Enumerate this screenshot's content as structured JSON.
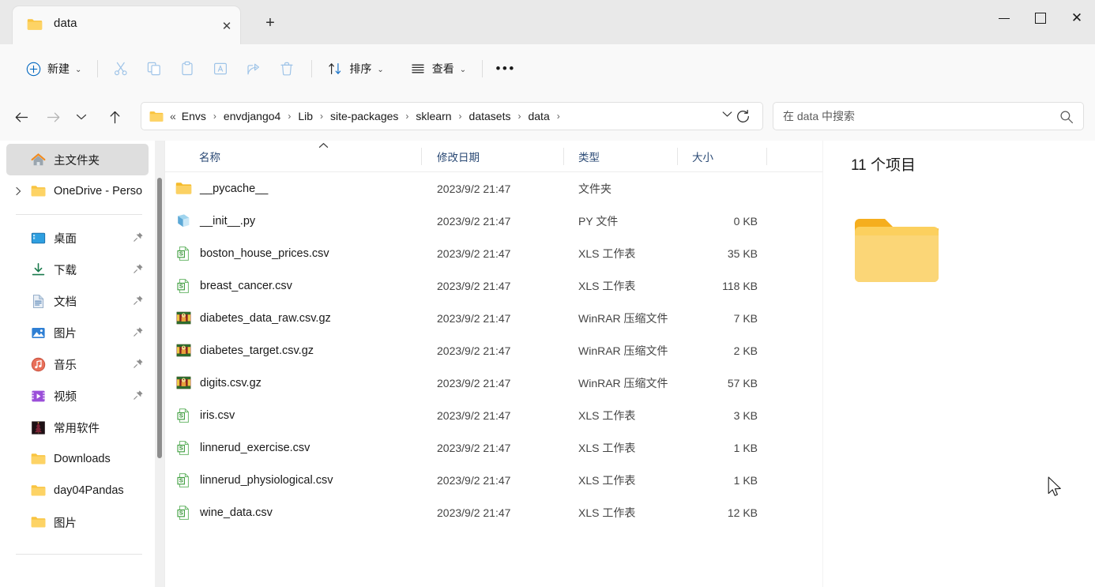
{
  "window": {
    "tab_title": "data",
    "tab_close_label": "✕",
    "newtab_label": "+",
    "minimize_label": "",
    "maximize_label": "",
    "close_label": "✕"
  },
  "toolbar": {
    "new_label": "新建",
    "cut_label": "剪切",
    "copy_label": "复制",
    "paste_label": "粘贴",
    "rename_label": "重命名",
    "share_label": "共享",
    "delete_label": "删除",
    "sort_label": "排序",
    "view_label": "查看",
    "more_label": "•••",
    "chevron": "⌄"
  },
  "nav": {
    "back_label": "←",
    "forward_label": "→",
    "recent_label": "⌄",
    "up_label": "↑",
    "refresh_label": "↻",
    "address_chevron": "⌄",
    "path_prefix": "«",
    "breadcrumbs": [
      "Envs",
      "envdjango4",
      "Lib",
      "site-packages",
      "sklearn",
      "datasets",
      "data"
    ],
    "breadcrumb_separator": "›",
    "trailing_separator": "›"
  },
  "search": {
    "placeholder": "在 data 中搜索"
  },
  "sidebar": {
    "items": [
      {
        "label": "主文件夹",
        "icon": "home-icon",
        "selected": true,
        "expandable": false,
        "pinned": false
      },
      {
        "label": "OneDrive - Perso",
        "icon": "folder-icon",
        "selected": false,
        "expandable": true,
        "pinned": false
      },
      {
        "divider": true
      },
      {
        "label": "桌面",
        "icon": "desktop-icon",
        "selected": false,
        "expandable": false,
        "pinned": true
      },
      {
        "label": "下载",
        "icon": "download-icon",
        "selected": false,
        "expandable": false,
        "pinned": true
      },
      {
        "label": "文档",
        "icon": "document-icon",
        "selected": false,
        "expandable": false,
        "pinned": true
      },
      {
        "label": "图片",
        "icon": "pictures-icon",
        "selected": false,
        "expandable": false,
        "pinned": true
      },
      {
        "label": "音乐",
        "icon": "music-icon",
        "selected": false,
        "expandable": false,
        "pinned": true
      },
      {
        "label": "视频",
        "icon": "video-icon",
        "selected": false,
        "expandable": false,
        "pinned": true
      },
      {
        "label": "常用软件",
        "icon": "app-icon",
        "selected": false,
        "expandable": false,
        "pinned": false
      },
      {
        "label": "Downloads",
        "icon": "folder-icon",
        "selected": false,
        "expandable": false,
        "pinned": false
      },
      {
        "label": "day04Pandas",
        "icon": "folder-icon",
        "selected": false,
        "expandable": false,
        "pinned": false
      },
      {
        "label": "图片",
        "icon": "folder-icon",
        "selected": false,
        "expandable": false,
        "pinned": false
      },
      {
        "divider": true
      }
    ]
  },
  "filelist": {
    "columns": [
      "名称",
      "修改日期",
      "类型",
      "大小"
    ],
    "sort_indicator": "⌃",
    "rows": [
      {
        "name": "__pycache__",
        "date": "2023/9/2 21:47",
        "type": "文件夹",
        "size": "",
        "icon": "folder-icon"
      },
      {
        "name": "__init__.py",
        "date": "2023/9/2 21:47",
        "type": "PY 文件",
        "size": "0 KB",
        "icon": "python-file-icon"
      },
      {
        "name": "boston_house_prices.csv",
        "date": "2023/9/2 21:47",
        "type": "XLS 工作表",
        "size": "35 KB",
        "icon": "csv-file-icon"
      },
      {
        "name": "breast_cancer.csv",
        "date": "2023/9/2 21:47",
        "type": "XLS 工作表",
        "size": "118 KB",
        "icon": "csv-file-icon"
      },
      {
        "name": "diabetes_data_raw.csv.gz",
        "date": "2023/9/2 21:47",
        "type": "WinRAR 压缩文件",
        "size": "7 KB",
        "icon": "winrar-file-icon"
      },
      {
        "name": "diabetes_target.csv.gz",
        "date": "2023/9/2 21:47",
        "type": "WinRAR 压缩文件",
        "size": "2 KB",
        "icon": "winrar-file-icon"
      },
      {
        "name": "digits.csv.gz",
        "date": "2023/9/2 21:47",
        "type": "WinRAR 压缩文件",
        "size": "57 KB",
        "icon": "winrar-file-icon"
      },
      {
        "name": "iris.csv",
        "date": "2023/9/2 21:47",
        "type": "XLS 工作表",
        "size": "3 KB",
        "icon": "csv-file-icon"
      },
      {
        "name": "linnerud_exercise.csv",
        "date": "2023/9/2 21:47",
        "type": "XLS 工作表",
        "size": "1 KB",
        "icon": "csv-file-icon"
      },
      {
        "name": "linnerud_physiological.csv",
        "date": "2023/9/2 21:47",
        "type": "XLS 工作表",
        "size": "1 KB",
        "icon": "csv-file-icon"
      },
      {
        "name": "wine_data.csv",
        "date": "2023/9/2 21:47",
        "type": "XLS 工作表",
        "size": "12 KB",
        "icon": "csv-file-icon"
      }
    ]
  },
  "details": {
    "item_count": "11 个项目"
  },
  "colors": {
    "folder_yellow": "#ffc849",
    "folder_yellow_light": "#ffd870",
    "accent_blue": "#0067c0",
    "header_text": "#2b4a75",
    "titlebar_bg": "#e9e9e9",
    "toolbar_bg": "#f9f9f9"
  }
}
